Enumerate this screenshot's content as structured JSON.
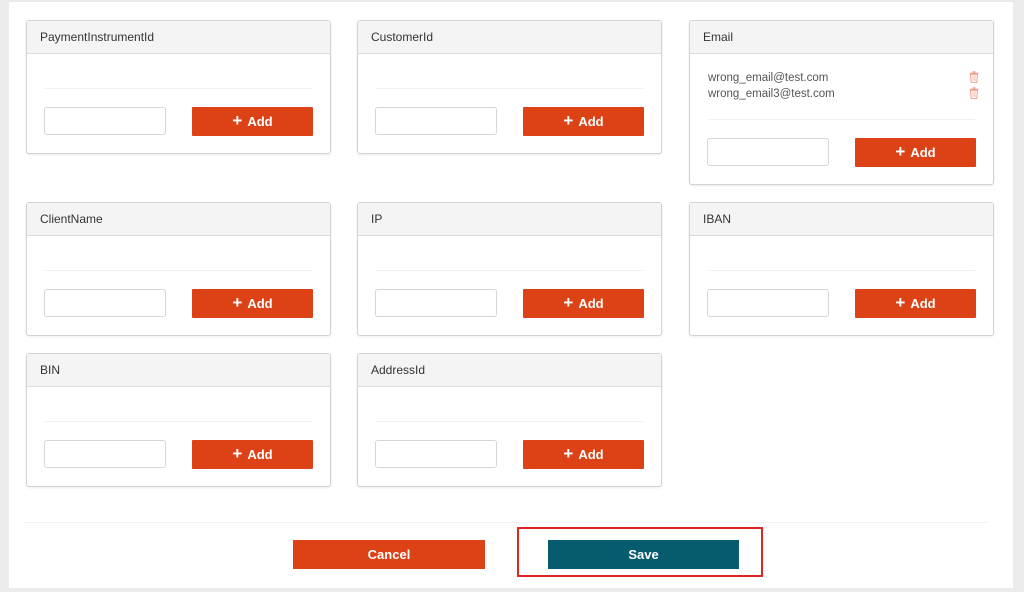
{
  "add_label": "Add",
  "cards": {
    "payment_instrument_id": {
      "title": "PaymentInstrumentId",
      "input_value": ""
    },
    "customer_id": {
      "title": "CustomerId",
      "input_value": ""
    },
    "email": {
      "title": "Email",
      "input_value": "",
      "items": [
        "wrong_email@test.com",
        "wrong_email3@test.com"
      ]
    },
    "client_name": {
      "title": "ClientName",
      "input_value": ""
    },
    "ip": {
      "title": "IP",
      "input_value": ""
    },
    "iban": {
      "title": "IBAN",
      "input_value": ""
    },
    "bin": {
      "title": "BIN",
      "input_value": ""
    },
    "address_id": {
      "title": "AddressId",
      "input_value": ""
    }
  },
  "actions": {
    "cancel_label": "Cancel",
    "save_label": "Save"
  },
  "colors": {
    "accent": "#dc4216",
    "save": "#075b6e",
    "highlight": "#e02525",
    "trash_icon": "#f0a090"
  }
}
